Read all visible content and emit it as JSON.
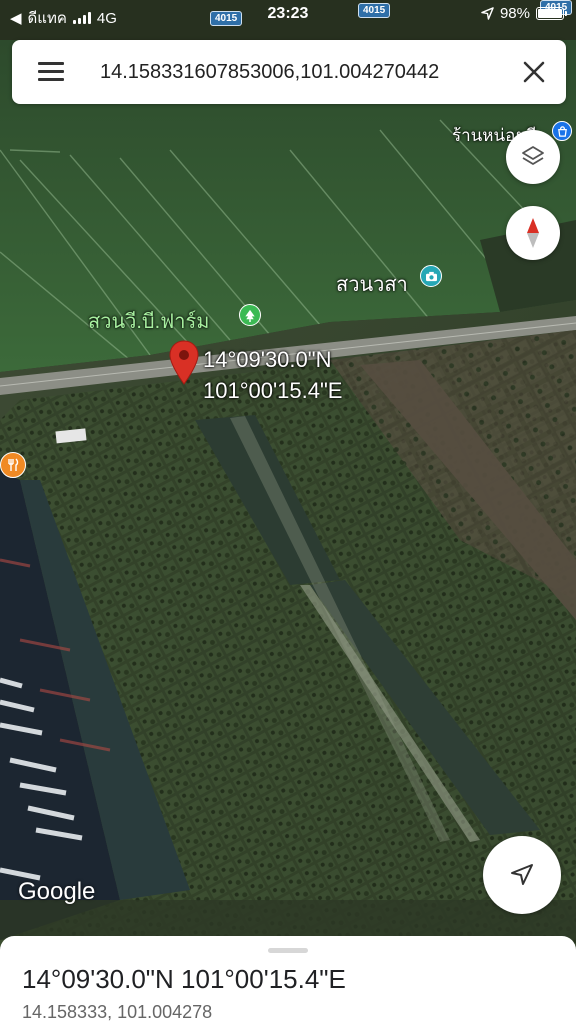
{
  "status_bar": {
    "carrier": "ดีแทค",
    "network": "4G",
    "time": "23:23",
    "battery": "98%",
    "battery_level": 0.98
  },
  "road_shields": [
    "4015",
    "4015",
    "4015"
  ],
  "search": {
    "value": "14.158331607853006,101.004270442",
    "menu_icon": "hamburger-menu-icon",
    "close_icon": "close-icon"
  },
  "places": {
    "store": "ร้านหน่อยดี",
    "farm": "สวนวี.บี.ฟาร์ม",
    "garden": "สวนวสา"
  },
  "pin": {
    "line1": "14°09'30.0\"N",
    "line2": "101°00'15.4\"E",
    "color": "#d93025"
  },
  "controls": {
    "layers_icon": "layers-icon",
    "compass_icon": "compass-icon",
    "my_location_icon": "navigation-arrow-icon"
  },
  "attribution": "Google",
  "sheet": {
    "title": "14°09'30.0\"N 101°00'15.4\"E",
    "subtitle": "14.158333, 101.004278"
  },
  "colors": {
    "accent": "#1a73e8",
    "poi_teal": "#26a7b5",
    "poi_green": "#3cba54",
    "poi_orange": "#f08a24"
  }
}
